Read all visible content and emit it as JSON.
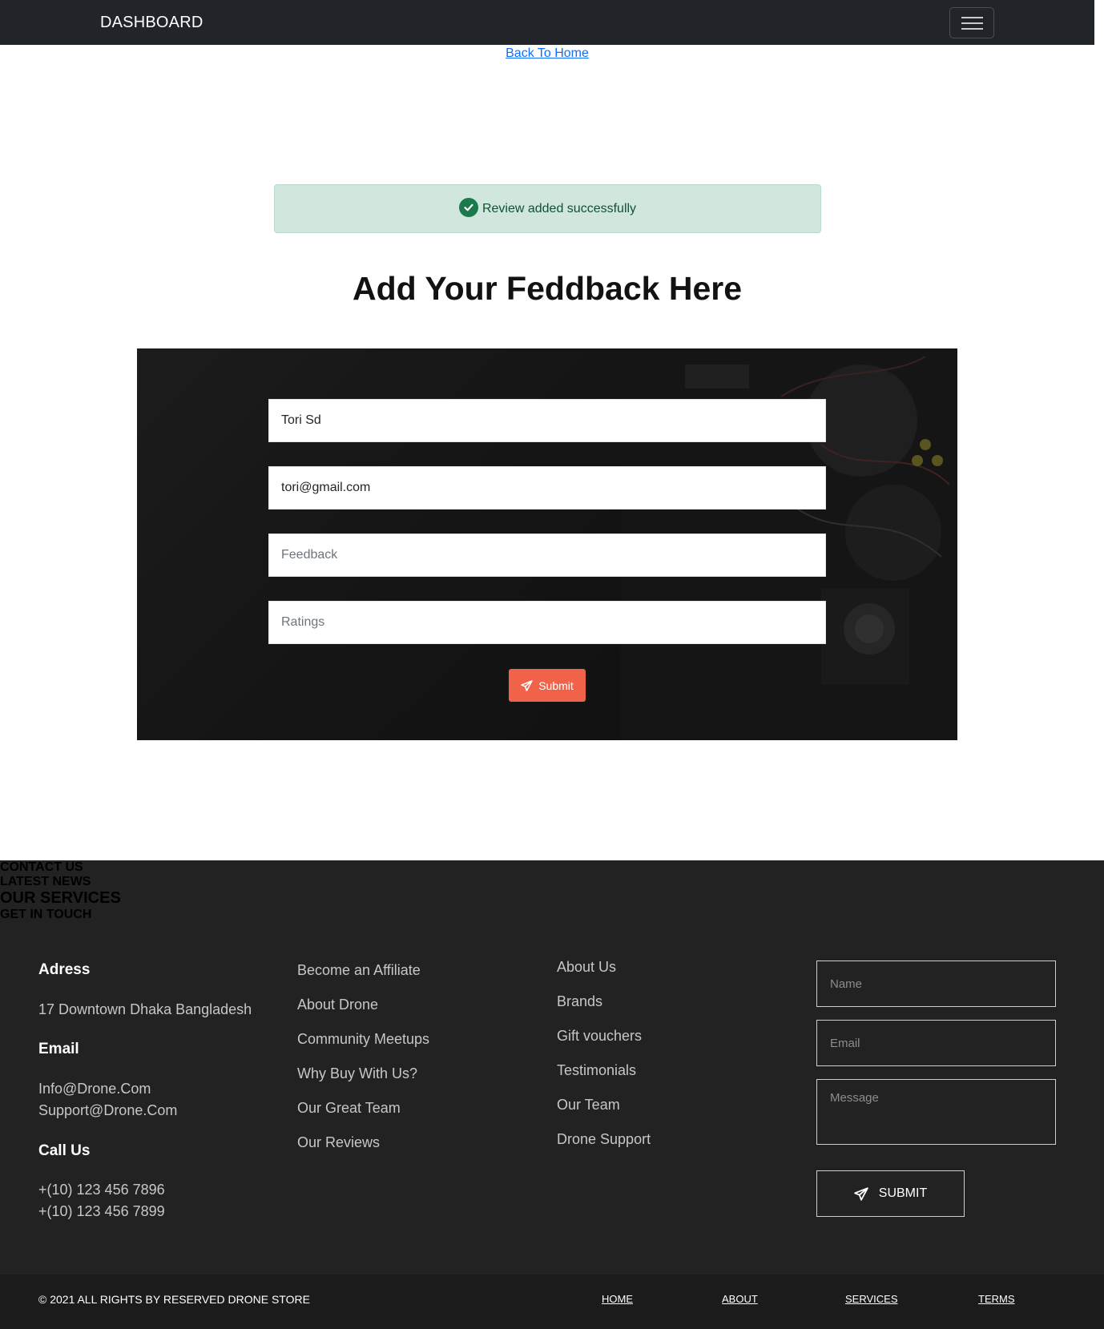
{
  "navbar": {
    "brand": "DASHBOARD",
    "menu_icon": "hamburger-menu-icon"
  },
  "back_link": "Back To Home",
  "alert": {
    "message": "Review added successfully",
    "icon": "check-circle-icon",
    "color": "#d1e7dd"
  },
  "title": "Add Your Feddback Here",
  "form": {
    "name_value": "Tori Sd",
    "email_value": "tori@gmail.com",
    "feedback_placeholder": "Feedback",
    "ratings_placeholder": "Ratings",
    "submit_label": "Submit",
    "submit_icon": "paper-plane-icon",
    "submit_color": "#f0634a"
  },
  "footer": {
    "contact": {
      "heading": "CONTACT US",
      "address_label": "Adress",
      "address": "17 Downtown Dhaka Bangladesh",
      "email_label": "Email",
      "email_1": "Info@Drone.Com",
      "email_2": "Support@Drone.Com",
      "call_label": "Call Us",
      "phone_1": "+(10) 123 456 7896",
      "phone_2": "+(10) 123 456 7899"
    },
    "news": {
      "heading": "LATEST NEWS",
      "items": [
        "Become an Affiliate",
        "About Drone",
        "Community Meetups",
        "Why Buy With Us?",
        "Our Great Team",
        "Our Reviews"
      ]
    },
    "services": {
      "heading": "OUR SERVICES",
      "items": [
        "About Us",
        "Brands",
        "Gift vouchers",
        "Testimonials",
        "Our Team",
        "Drone Support"
      ]
    },
    "touch": {
      "heading": "GET IN TOUCH",
      "name_placeholder": "Name",
      "email_placeholder": "Email",
      "message_placeholder": "Message",
      "submit_label": "SUBMIT",
      "submit_icon": "paper-plane-icon"
    }
  },
  "bottom": {
    "copyright": "© 2021 ALL RIGHTS BY RESERVED DRONE STORE",
    "links": [
      "HOME",
      "ABOUT",
      "SERVICES",
      "TERMS"
    ]
  }
}
